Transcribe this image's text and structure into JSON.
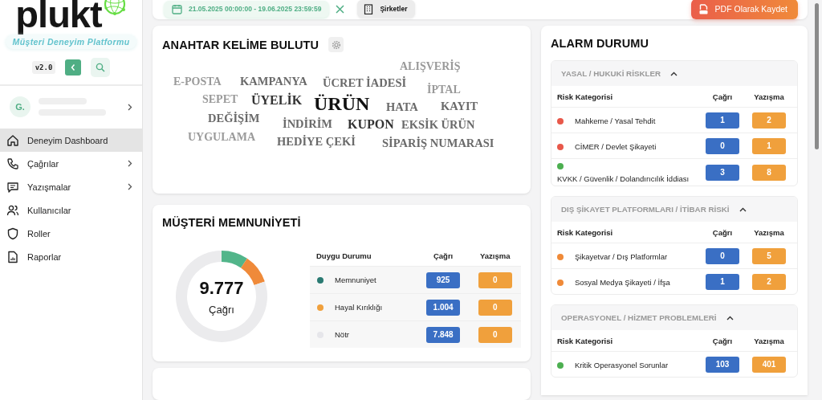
{
  "sidebar": {
    "logo": "plukt",
    "tagline": "Müşteri Deneyim Platformu",
    "version": "v2.0",
    "user": {
      "initials": "G.",
      "loading": true
    },
    "items": [
      {
        "label": "Deneyim Dashboard",
        "selected": true,
        "expandable": false
      },
      {
        "label": "Çağrılar",
        "selected": false,
        "expandable": true
      },
      {
        "label": "Yazışmalar",
        "selected": false,
        "expandable": true
      },
      {
        "label": "Kullanıcılar",
        "selected": false,
        "expandable": false
      },
      {
        "label": "Roller",
        "selected": false,
        "expandable": false
      },
      {
        "label": "Raporlar",
        "selected": false,
        "expandable": false
      }
    ]
  },
  "toolbar": {
    "date_range": "21.05.2025 00:00:00 - 19.06.2025 23:59:59",
    "companies_button": "Şirketler",
    "pdf_button": "PDF Olarak Kaydet"
  },
  "keyword_cloud": {
    "title": "ANAHTAR KELİME BULUTU",
    "words": [
      {
        "text": "ALIŞVERİŞ",
        "kind": "light"
      },
      {
        "text": "E-POSTA",
        "kind": "light"
      },
      {
        "text": "KAMPANYA",
        "kind": "medium"
      },
      {
        "text": "ÜCRET İADESİ",
        "kind": "medium"
      },
      {
        "text": "İPTAL",
        "kind": "light"
      },
      {
        "text": "SEPET",
        "kind": "light"
      },
      {
        "text": "ÜYELİK",
        "kind": "strong"
      },
      {
        "text": "ÜRÜN",
        "kind": "top"
      },
      {
        "text": "HATA",
        "kind": "medium"
      },
      {
        "text": "KAYIT",
        "kind": "medium"
      },
      {
        "text": "DEĞİŞİM",
        "kind": "medium"
      },
      {
        "text": "İNDİRİM",
        "kind": "medium"
      },
      {
        "text": "KUPON",
        "kind": "strong"
      },
      {
        "text": "EKSİK ÜRÜN",
        "kind": "medium"
      },
      {
        "text": "UYGULAMA",
        "kind": "light"
      },
      {
        "text": "HEDİYE ÇEKİ",
        "kind": "medium"
      },
      {
        "text": "SİPARİŞ NUMARASI",
        "kind": "medium"
      }
    ]
  },
  "satisfaction": {
    "title": "MÜŞTERİ MEMNUNİYETİ",
    "total": "9.777",
    "total_label": "Çağrı",
    "columns": [
      "Duygu Durumu",
      "Çağrı",
      "Yazışma"
    ],
    "rows": [
      {
        "label": "Memnuniyet",
        "color": "#2a7a72",
        "calls": "925",
        "messages": "0"
      },
      {
        "label": "Hayal Kırıklığı",
        "color": "#f0a03c",
        "calls": "1.004",
        "messages": "0"
      },
      {
        "label": "Nötr",
        "color": "#e6e6ea",
        "calls": "7.848",
        "messages": "0"
      }
    ]
  },
  "alarms": {
    "title": "ALARM DURUMU",
    "groups": [
      {
        "title": "YASAL / HUKUKİ RİSKLER",
        "expanded": true,
        "columns": [
          "Risk Kategorisi",
          "Çağrı",
          "Yazışma"
        ],
        "rows": [
          {
            "label": "Mahkeme / Yasal Tehdit",
            "color": "#e8584a",
            "calls": "1",
            "messages": "2"
          },
          {
            "label": "CİMER / Devlet Şikayeti",
            "color": "#e8584a",
            "calls": "0",
            "messages": "1"
          },
          {
            "label": "KVKK / Güvenlik / Dolandırıcılık İddiası",
            "color": "#4caf50",
            "calls": "3",
            "messages": "8"
          }
        ]
      },
      {
        "title": "DIŞ ŞİKAYET PLATFORMLARI / İTİBAR RİSKİ",
        "expanded": true,
        "columns": [
          "Risk Kategorisi",
          "Çağrı",
          "Yazışma"
        ],
        "rows": [
          {
            "label": "Şikayetvar / Dış Platformlar",
            "color": "#f08a38",
            "calls": "0",
            "messages": "5"
          },
          {
            "label": "Sosyal Medya Şikayeti / İfşa",
            "color": "#f08a38",
            "calls": "1",
            "messages": "2"
          }
        ]
      },
      {
        "title": "OPERASYONEL / HİZMET PROBLEMLERİ",
        "expanded": true,
        "columns": [
          "Risk Kategorisi",
          "Çağrı",
          "Yazışma"
        ],
        "rows": [
          {
            "label": "Kritik Operasyonel Sorunlar",
            "color": "#4caf50",
            "calls": "103",
            "messages": "401"
          }
        ]
      }
    ]
  }
}
